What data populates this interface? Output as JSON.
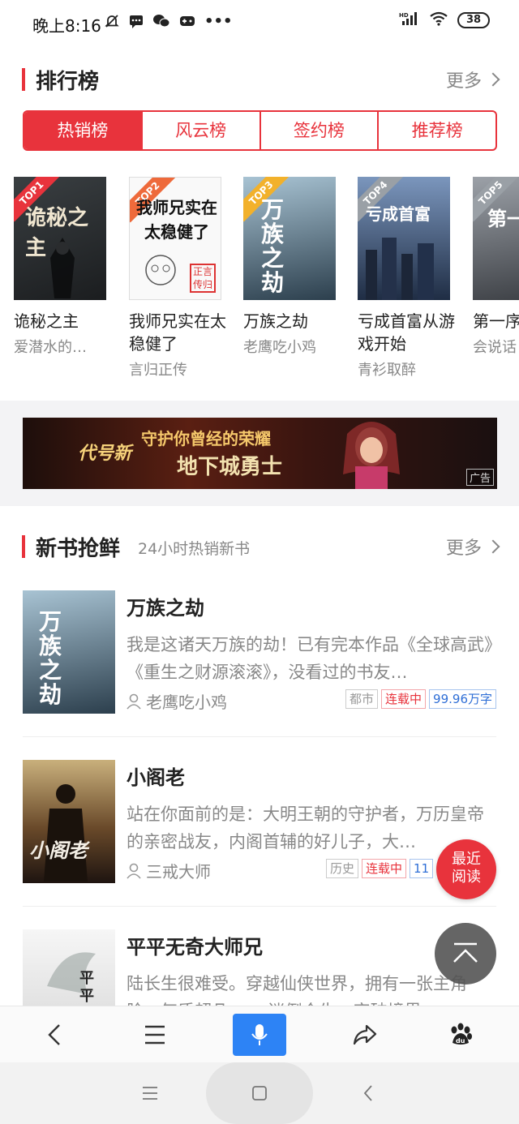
{
  "status_bar": {
    "time": "晚上8:16",
    "battery": "38",
    "signal": "HD",
    "icons": [
      "mute-bell-icon",
      "message-icon",
      "wechat-icon",
      "game-icon",
      "more-icon"
    ]
  },
  "ranking": {
    "title": "排行榜",
    "more": "更多",
    "tabs": [
      "热销榜",
      "风云榜",
      "签约榜",
      "推荐榜"
    ],
    "active_tab": 0,
    "books": [
      {
        "rank": "TOP1",
        "title": "诡秘之主",
        "author": "爱潜水的…",
        "cover_text": "诡秘之主",
        "badge_color": "#e8333c",
        "cover_colors": [
          "#3a3f42",
          "#1b1d1f"
        ]
      },
      {
        "rank": "TOP2",
        "title": "我师兄实在太稳健了",
        "author": "言归正传",
        "cover_text": "我师兄实在太稳健了",
        "badge_color": "#ee6a3b",
        "cover_colors": [
          "#fbfbfb",
          "#eeeeee"
        ]
      },
      {
        "rank": "TOP3",
        "title": "万族之劫",
        "author": "老鹰吃小鸡",
        "cover_text": "万族之劫",
        "badge_color": "#f2b12b",
        "cover_colors": [
          "#7fa3b8",
          "#2c3f4d"
        ]
      },
      {
        "rank": "TOP4",
        "title": "亏成首富从游戏开始",
        "author": "青衫取醉",
        "cover_text": "亏成首富",
        "badge_color": "#9aa0a6",
        "cover_colors": [
          "#5e7aa5",
          "#1f2d44"
        ]
      },
      {
        "rank": "TOP5",
        "title": "第一序",
        "author": "会说话",
        "cover_text": "第一",
        "badge_color": "#9aa0a6",
        "cover_colors": [
          "#8a8f96",
          "#3a3d42"
        ]
      }
    ]
  },
  "ad": {
    "line1": "守护你曾经的荣耀",
    "line2": "地下城勇士",
    "brand": "代号新",
    "label": "广告"
  },
  "new_books": {
    "title": "新书抢鲜",
    "subtitle": "24小时热销新书",
    "more": "更多",
    "items": [
      {
        "title": "万族之劫",
        "desc": "我是这诸天万族的劫！已有完本作品《全球高武》《重生之财源滚滚》，没看过的书友…",
        "author": "老鹰吃小鸡",
        "tags": [
          "都市",
          "连载中",
          "99.96万字"
        ],
        "cover_text": "万族之劫",
        "cover_colors": [
          "#7fa3b8",
          "#2c3f4d"
        ]
      },
      {
        "title": "小阁老",
        "desc": "站在你面前的是：大明王朝的守护者，万历皇帝的亲密战友，内阁首辅的好儿子，大…",
        "author": "三戒大师",
        "tags": [
          "历史",
          "连载中",
          "11"
        ],
        "cover_text": "小阁老",
        "cover_colors": [
          "#b5996a",
          "#3a2a1a"
        ]
      },
      {
        "title": "平平无奇大师兄",
        "desc": "陆长生很难受。穿越仙侠世界，拥有一张主角脸，气质超凡，… 迷倒众生，突破境界…",
        "author": "",
        "tags": [],
        "cover_text": "平平",
        "cover_colors": [
          "#f2f2f2",
          "#d6d6d6"
        ]
      }
    ]
  },
  "floating": {
    "recent_line1": "最近",
    "recent_line2": "阅读"
  },
  "colors": {
    "accent": "#e8333c",
    "blue": "#2d83f5"
  }
}
